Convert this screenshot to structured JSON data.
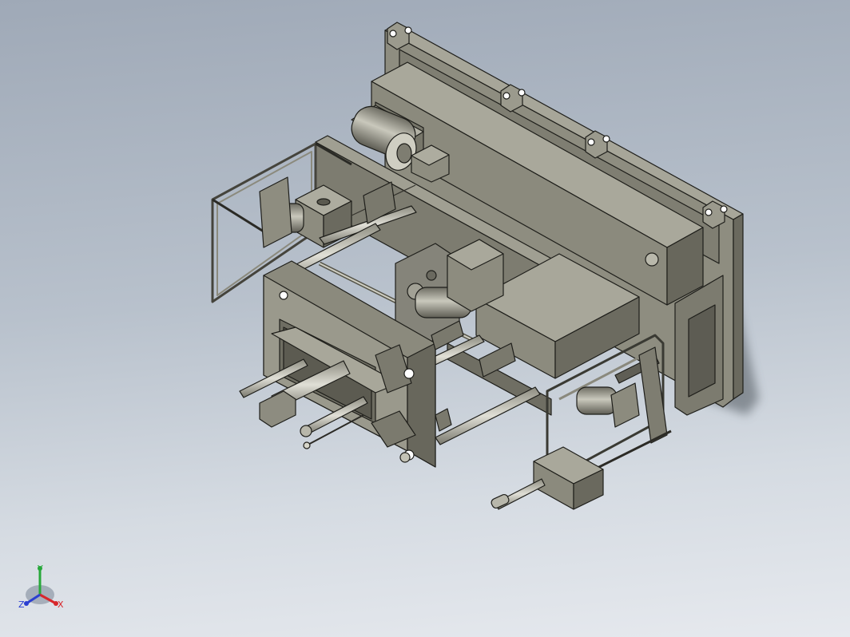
{
  "viewport": {
    "background_top": "#9fa9b7",
    "background_bottom": "#e6e9ee"
  },
  "model": {
    "body_color": "#8b8a7c",
    "light_face_color": "#a5a497",
    "dark_face_color": "#66655a",
    "edge_color": "#1e1e1a"
  },
  "triad": {
    "x_label": "X",
    "y_label": "Y",
    "z_label": "Z",
    "x_color": "#d8262b",
    "y_color": "#27a83a",
    "z_color": "#2b3fd1"
  }
}
